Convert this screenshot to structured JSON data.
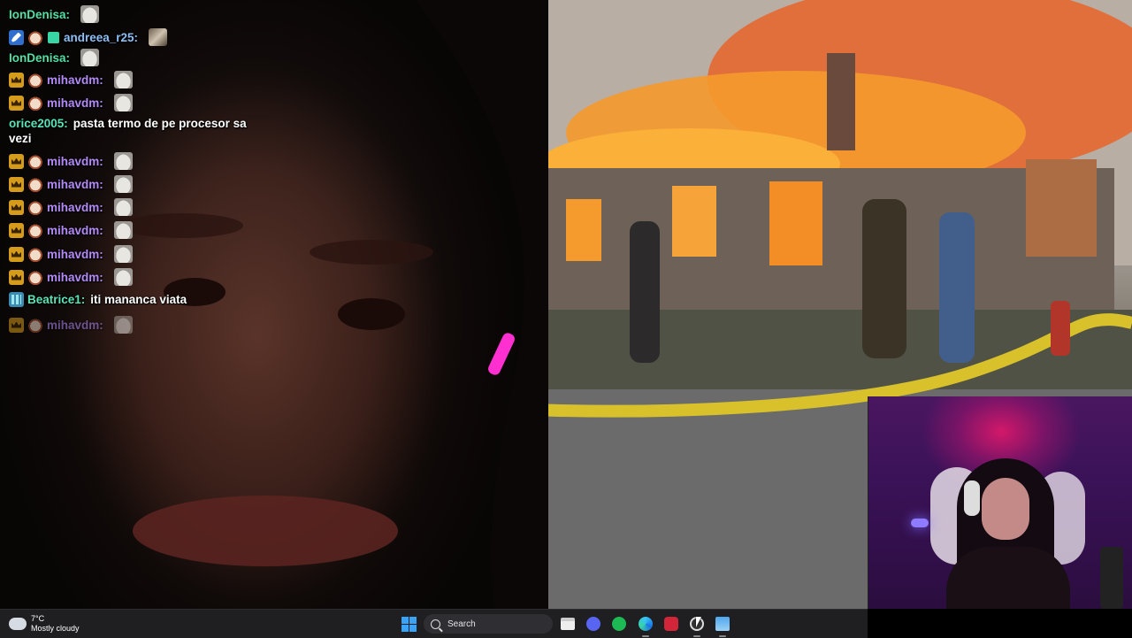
{
  "chat": {
    "messages": [
      {
        "user": "IonDenisa:",
        "text": "",
        "color": "#53e0a2",
        "badges": [],
        "emote": "cat"
      },
      {
        "user": "andreea_r25:",
        "text": "",
        "color": "#8dbff5",
        "badges": [
          "tool-badge",
          "face-emote",
          "gift-badge"
        ],
        "emote": "cat2"
      },
      {
        "user": "IonDenisa:",
        "text": "",
        "color": "#53e0a2",
        "badges": [],
        "emote": "cat"
      },
      {
        "user": "mihavdm:",
        "text": "",
        "color": "#b38af7",
        "badges": [
          "crown-badge",
          "face-emote"
        ],
        "emote": "cat"
      },
      {
        "user": "mihavdm:",
        "text": "",
        "color": "#b38af7",
        "badges": [
          "crown-badge",
          "face-emote"
        ],
        "emote": "cat"
      },
      {
        "user": "orice2005:",
        "text": "pasta termo de pe procesor sa vezi",
        "color": "#59e3b6",
        "badges": []
      },
      {
        "user": "mihavdm:",
        "text": "",
        "color": "#b38af7",
        "badges": [
          "crown-badge",
          "face-emote"
        ],
        "emote": "cat"
      },
      {
        "user": "mihavdm:",
        "text": "",
        "color": "#b38af7",
        "badges": [
          "crown-badge",
          "face-emote"
        ],
        "emote": "cat"
      },
      {
        "user": "mihavdm:",
        "text": "",
        "color": "#b38af7",
        "badges": [
          "crown-badge",
          "face-emote"
        ],
        "emote": "cat"
      },
      {
        "user": "mihavdm:",
        "text": "",
        "color": "#b38af7",
        "badges": [
          "crown-badge",
          "face-emote"
        ],
        "emote": "cat"
      },
      {
        "user": "mihavdm:",
        "text": "",
        "color": "#b38af7",
        "badges": [
          "crown-badge",
          "face-emote"
        ],
        "emote": "cat"
      },
      {
        "user": "mihavdm:",
        "text": "",
        "color": "#b38af7",
        "badges": [
          "crown-badge",
          "face-emote"
        ],
        "emote": "cat"
      },
      {
        "user": "Beatrice1:",
        "text": "iti mananca viata",
        "color": "#59e3b6",
        "badges": [
          "sub-badge"
        ]
      },
      {
        "user": "mihavdm:",
        "text": "",
        "color": "#b38af7",
        "badges": [
          "crown-badge",
          "face-emote"
        ],
        "emote": "cat",
        "fading": true
      }
    ]
  },
  "taskbar": {
    "weather": {
      "temp": "7°C",
      "condition": "Mostly cloudy",
      "icon": "partly-cloudy-icon"
    },
    "search_label": "Search",
    "apps": [
      "start-icon",
      "file-explorer-icon",
      "discord-icon",
      "spotify-icon",
      "edge-icon",
      "red-app-icon",
      "obs-icon",
      "photos-icon"
    ]
  }
}
